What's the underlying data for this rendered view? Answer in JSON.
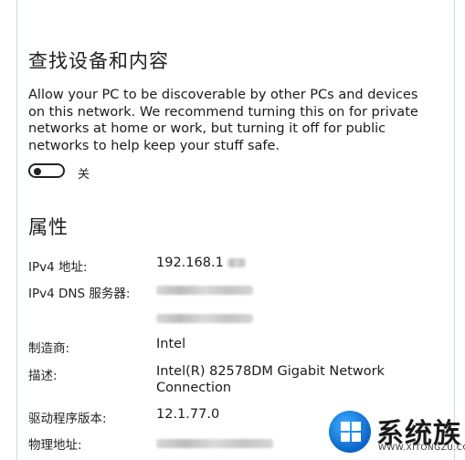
{
  "discovery": {
    "title": "查找设备和内容",
    "description": "Allow your PC to be discoverable by other PCs and devices on this network. We recommend turning this on for private networks at home or work, but turning it off for public networks to help keep your stuff safe.",
    "toggle_state_label": "关",
    "toggle_on": false
  },
  "properties": {
    "title": "属性",
    "rows": [
      {
        "key": "IPv4 地址:",
        "value": "192.168.1"
      },
      {
        "key": "IPv4 DNS 服务器:",
        "value": ""
      },
      {
        "key": "",
        "value": ""
      },
      {
        "key": "制造商:",
        "value": "Intel"
      },
      {
        "key": "描述:",
        "value": "Intel(R) 82578DM Gigabit Network Connection"
      },
      {
        "key": "驱动程序版本:",
        "value": "12.1.77.0"
      },
      {
        "key": "物理地址:",
        "value": ""
      }
    ]
  },
  "watermark": {
    "name": "系统族",
    "url": "WWW.XITONGZU.COM",
    "colors": {
      "circle": "#0a63c9",
      "accent": "#3fb0ff"
    }
  }
}
